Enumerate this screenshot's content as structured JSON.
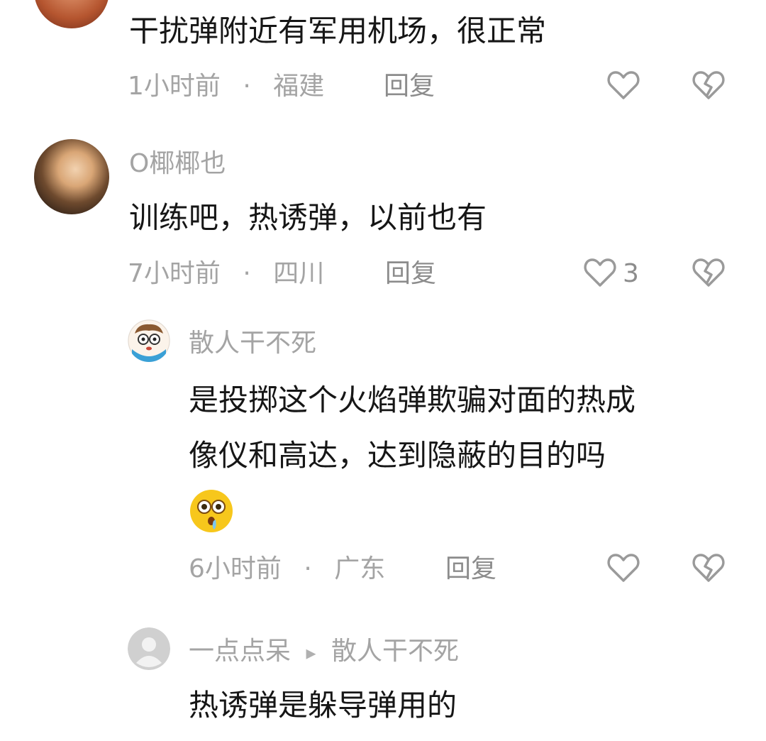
{
  "comments": [
    {
      "text": "干扰弹附近有军用机场，很正常",
      "time": "1小时前",
      "location": "福建",
      "reply_label": "回复",
      "like_icon": "heart-outline-icon",
      "dislike_icon": "broken-heart-icon"
    },
    {
      "username": "O椰椰也",
      "text": "训练吧，热诱弹，以前也有",
      "time": "7小时前",
      "location": "四川",
      "reply_label": "回复",
      "like_count": "3",
      "like_icon": "heart-outline-icon",
      "dislike_icon": "broken-heart-icon"
    }
  ],
  "replies": [
    {
      "username": "散人干不死",
      "text_line1": "是投掷这个火焰弹欺骗对面的热成",
      "text_line2": "像仪和高达，达到隐蔽的目的吗",
      "emoji": "shocked-face-emoji",
      "time": "6小时前",
      "location": "广东",
      "reply_label": "回复",
      "like_icon": "heart-outline-icon",
      "dislike_icon": "broken-heart-icon"
    },
    {
      "username": "一点点呆",
      "arrow": "▸",
      "reply_to": "散人干不死",
      "text": "热诱弹是躲导弹用的"
    }
  ],
  "separator": "·",
  "colors": {
    "text": "#161616",
    "meta": "#a4a4a4",
    "icon": "#9a9a9a"
  }
}
